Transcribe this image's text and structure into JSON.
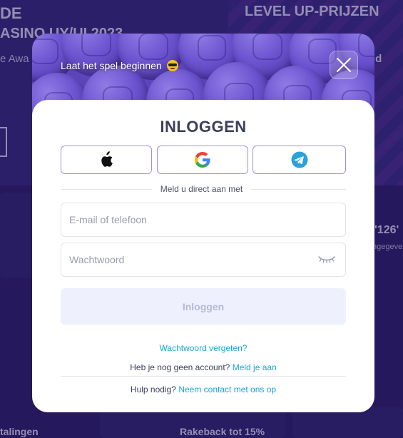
{
  "background": {
    "title_left_line1": "DE",
    "title_left_line2": "ASINO UY/UI 2023",
    "subtitle_left": "e Awa",
    "title_right": "LEVEL UP-PRIJZEN",
    "fragment_right": "id",
    "number_right": "'126'",
    "small_right": "ngegeve",
    "bottom_left": "talingen",
    "bottom_mid": "Rakeback tot 15%"
  },
  "modal": {
    "header_text": "Laat het spel beginnen",
    "header_emoji": "sunglasses-emoji",
    "title": "INLOGGEN",
    "social": [
      {
        "name": "apple",
        "icon": "apple-icon"
      },
      {
        "name": "google",
        "icon": "google-icon"
      },
      {
        "name": "telegram",
        "icon": "telegram-icon"
      }
    ],
    "divider_text": "Meld u direct aan met",
    "email_placeholder": "E-mail of telefoon",
    "password_placeholder": "Wachtwoord",
    "submit_label": "Inloggen",
    "forgot_password": "Wachtwoord vergeten?",
    "no_account_text": "Heb je nog geen account?",
    "register_link": "Meld je aan",
    "help_text": "Hulp nodig?",
    "contact_link": "Neem contact met ons op"
  },
  "colors": {
    "accent_link": "#17a6d6",
    "title": "#3b3f5c",
    "button_disabled_bg": "#eef1fd",
    "social_border": "#9a94d6",
    "background_purple": "#2b1e66"
  }
}
